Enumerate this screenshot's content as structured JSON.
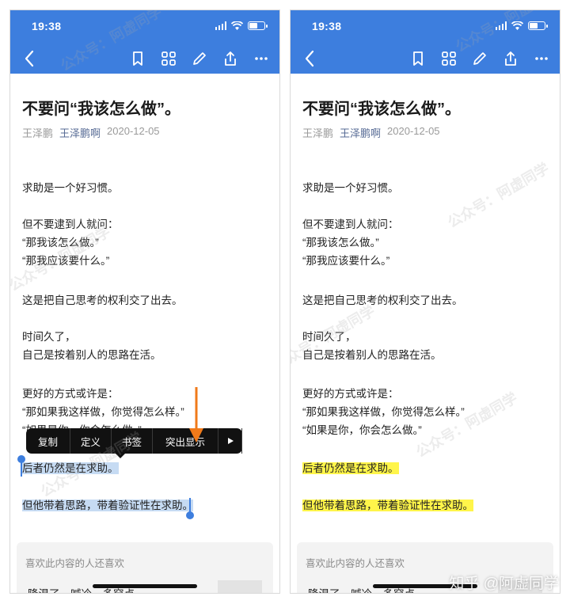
{
  "status": {
    "time": "19:38"
  },
  "article": {
    "title": "不要问“我该怎么做”。",
    "author": "王泽鹏",
    "account": "王泽鹏啊",
    "date": "2020-12-05",
    "lines": {
      "p1": "求助是一个好习惯。",
      "p2a": "但不要逮到人就问：",
      "p2b": "“那我该怎么做。”",
      "p2c": "“那我应该要什么。”",
      "p3": "这是把自己思考的权利交了出去。",
      "p4a": "时间久了，",
      "p4b": "自己是按着别人的思路在活。",
      "p5a": "更好的方式或许是：",
      "p5b": "“那如果我这样做，你觉得怎么样。”",
      "p5c": "“如果是你，你会怎么做。”",
      "p6": "后者仍然是在求助。",
      "p7": "但他带着思路，带着验证性在求助。"
    }
  },
  "context_menu": {
    "items": [
      "复制",
      "定义",
      "书签",
      "突出显示"
    ],
    "more_icon": "play-triangle-icon"
  },
  "recommend": {
    "title": "喜欢此内容的人还喜欢",
    "item": "降温了，喊冷，多穿点"
  },
  "watermark": {
    "wechat": "公众号：阿虚同学",
    "zhihu": "知乎 @阿虚同学"
  },
  "colors": {
    "header_bg": "#3d7ede",
    "selection_highlight": "#c6dbf3",
    "yellow_highlight": "#fff54a",
    "annotation_arrow": "#f07a1a",
    "account_link": "#576b95"
  }
}
